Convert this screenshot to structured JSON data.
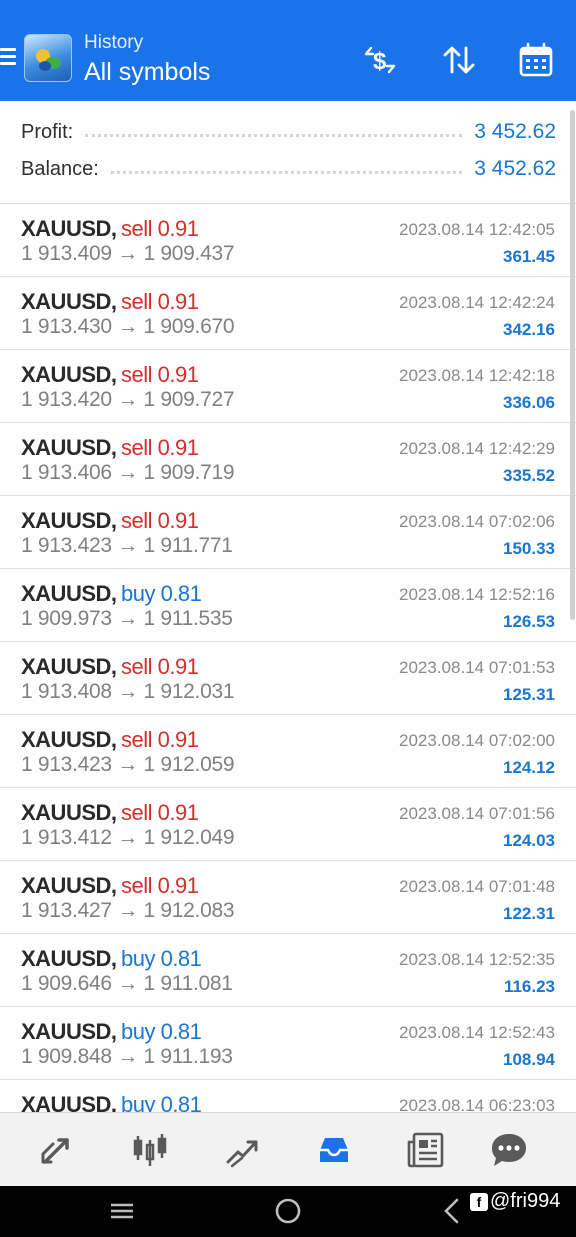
{
  "header": {
    "subtitle": "History",
    "title": "All symbols"
  },
  "summary": {
    "profit_label": "Profit:",
    "profit_value": "3 452.62",
    "balance_label": "Balance:",
    "balance_value": "3 452.62"
  },
  "deals": [
    {
      "symbol": "XAUUSD,",
      "side": "sell 0.91",
      "type": "sell",
      "prices": "1 913.409 → 1 909.437",
      "time": "2023.08.14 12:42:05",
      "profit": "361.45"
    },
    {
      "symbol": "XAUUSD,",
      "side": "sell 0.91",
      "type": "sell",
      "prices": "1 913.430 → 1 909.670",
      "time": "2023.08.14 12:42:24",
      "profit": "342.16"
    },
    {
      "symbol": "XAUUSD,",
      "side": "sell 0.91",
      "type": "sell",
      "prices": "1 913.420 → 1 909.727",
      "time": "2023.08.14 12:42:18",
      "profit": "336.06"
    },
    {
      "symbol": "XAUUSD,",
      "side": "sell 0.91",
      "type": "sell",
      "prices": "1 913.406 → 1 909.719",
      "time": "2023.08.14 12:42:29",
      "profit": "335.52"
    },
    {
      "symbol": "XAUUSD,",
      "side": "sell 0.91",
      "type": "sell",
      "prices": "1 913.423 → 1 911.771",
      "time": "2023.08.14 07:02:06",
      "profit": "150.33"
    },
    {
      "symbol": "XAUUSD,",
      "side": "buy 0.81",
      "type": "buy",
      "prices": "1 909.973 → 1 911.535",
      "time": "2023.08.14 12:52:16",
      "profit": "126.53"
    },
    {
      "symbol": "XAUUSD,",
      "side": "sell 0.91",
      "type": "sell",
      "prices": "1 913.408 → 1 912.031",
      "time": "2023.08.14 07:01:53",
      "profit": "125.31"
    },
    {
      "symbol": "XAUUSD,",
      "side": "sell 0.91",
      "type": "sell",
      "prices": "1 913.423 → 1 912.059",
      "time": "2023.08.14 07:02:00",
      "profit": "124.12"
    },
    {
      "symbol": "XAUUSD,",
      "side": "sell 0.91",
      "type": "sell",
      "prices": "1 913.412 → 1 912.049",
      "time": "2023.08.14 07:01:56",
      "profit": "124.03"
    },
    {
      "symbol": "XAUUSD,",
      "side": "sell 0.91",
      "type": "sell",
      "prices": "1 913.427 → 1 912.083",
      "time": "2023.08.14 07:01:48",
      "profit": "122.31"
    },
    {
      "symbol": "XAUUSD,",
      "side": "buy 0.81",
      "type": "buy",
      "prices": "1 909.646 → 1 911.081",
      "time": "2023.08.14 12:52:35",
      "profit": "116.23"
    },
    {
      "symbol": "XAUUSD,",
      "side": "buy 0.81",
      "type": "buy",
      "prices": "1 909.848 → 1 911.193",
      "time": "2023.08.14 12:52:43",
      "profit": "108.94"
    },
    {
      "symbol": "XAUUSD,",
      "side": "buy 0.81",
      "type": "buy",
      "prices": "",
      "time": "2023.08.14 06:23:03",
      "profit": ""
    }
  ],
  "icons": {
    "menu": "menu-icon",
    "logo": "metatrader-logo-icon",
    "currency": "currency-exchange-icon",
    "sort": "sort-icon",
    "calendar": "calendar-icon",
    "tabs": [
      "quotes-icon",
      "chart-icon",
      "trade-icon",
      "history-icon",
      "news-icon",
      "chat-icon"
    ]
  },
  "colors": {
    "header": "#1a73e8",
    "sell": "#d32f2f",
    "buy": "#1976d2",
    "profit": "#1976d2",
    "active_tab": "#1a73e8"
  },
  "watermark": {
    "text": "@fri994"
  }
}
